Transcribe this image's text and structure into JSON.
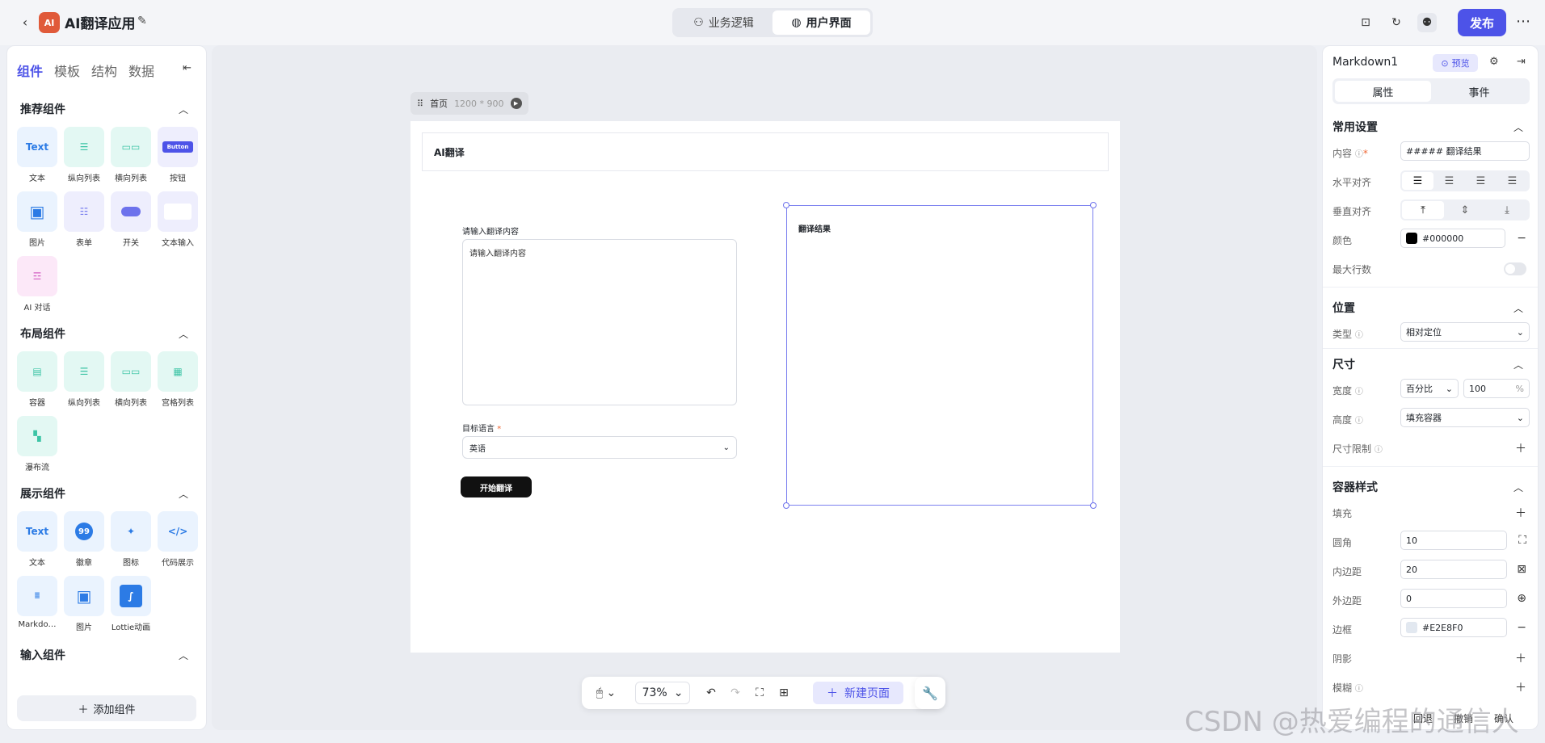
{
  "header": {
    "app_title": "AI翻译应用",
    "modes": [
      "业务逻辑",
      "用户界面"
    ],
    "active_mode": "用户界面",
    "publish_label": "发布"
  },
  "left_panel": {
    "tabs": [
      "组件",
      "模板",
      "结构",
      "数据"
    ],
    "sections": [
      {
        "title": "推荐组件",
        "items": [
          "文本",
          "纵向列表",
          "横向列表",
          "按钮",
          "图片",
          "表单",
          "开关",
          "文本输入",
          "AI 对话"
        ]
      },
      {
        "title": "布局组件",
        "items": [
          "容器",
          "纵向列表",
          "横向列表",
          "宫格列表",
          "瀑布流"
        ]
      },
      {
        "title": "展示组件",
        "items": [
          "文本",
          "徽章",
          "图标",
          "代码展示",
          "Markdo…",
          "图片",
          "Lottie动画"
        ]
      },
      {
        "title": "输入组件",
        "items": []
      }
    ],
    "tile_text": {
      "text_icon": "Text",
      "badge_count": "99",
      "button_icon": "Button"
    },
    "add_component": "添加组件"
  },
  "canvas": {
    "page_name": "首页",
    "page_size": "1200 * 900",
    "page": {
      "header_title": "AI翻译",
      "input_label": "请输入翻译内容",
      "input_placeholder": "请输入翻译内容",
      "target_label": "目标语言",
      "target_value": "英语",
      "button_label": "开始翻译",
      "result_title": "翻译结果"
    }
  },
  "bottom_toolbar": {
    "zoom": "73%",
    "new_page": "新建页面"
  },
  "right_panel": {
    "component_name": "Markdown1",
    "preview_label": "预览",
    "tabs": [
      "属性",
      "事件"
    ],
    "active_tab": "属性",
    "common": {
      "title": "常用设置",
      "content_label": "内容",
      "content_value": "##### 翻译结果",
      "h_align_label": "水平对齐",
      "v_align_label": "垂直对齐",
      "color_label": "颜色",
      "color_value": "#000000",
      "max_lines_label": "最大行数"
    },
    "position": {
      "title": "位置",
      "type_label": "类型",
      "type_value": "相对定位"
    },
    "size": {
      "title": "尺寸",
      "width_label": "宽度",
      "width_mode": "百分比",
      "width_value": "100",
      "width_unit": "%",
      "height_label": "高度",
      "height_value": "填充容器",
      "limit_label": "尺寸限制"
    },
    "container_style": {
      "title": "容器样式",
      "fill_label": "填充",
      "radius_label": "圆角",
      "radius_value": "10",
      "padding_label": "内边距",
      "padding_value": "20",
      "margin_label": "外边距",
      "margin_value": "0",
      "border_label": "边框",
      "border_value": "#E2E8F0",
      "shadow_label": "阴影",
      "blur_label": "模糊"
    },
    "footer": [
      "回退",
      "撤销",
      "确认"
    ]
  },
  "watermark": "CSDN @热爱编程的通信人",
  "colors": {
    "accent": "#4d53e8",
    "selection": "#7b80ef",
    "button_dark": "#111111"
  }
}
